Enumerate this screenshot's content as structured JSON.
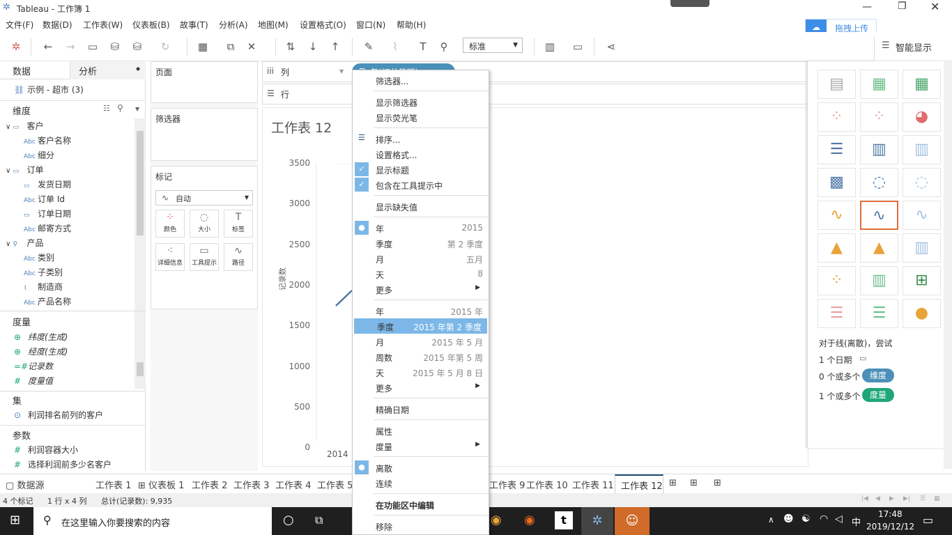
{
  "window": {
    "title": "Tableau - 工作簿 1"
  },
  "menu": [
    "文件(F)",
    "数据(D)",
    "工作表(W)",
    "仪表板(B)",
    "故事(T)",
    "分析(A)",
    "地图(M)",
    "设置格式(O)",
    "窗口(N)",
    "帮助(H)"
  ],
  "toolbar": {
    "fit_value": "标准",
    "upload_label": "拖拽上传",
    "show_me_label": "智能显示"
  },
  "left_pane": {
    "tab_data": "数据",
    "tab_analysis": "分析",
    "datasource": "示例 - 超市 (3)",
    "dimensions_label": "维度",
    "dimension_items": [
      {
        "label": "客户",
        "kind": "folder",
        "icon": "folder-icon"
      },
      {
        "label": "客户名称",
        "kind": "field",
        "icon": "abc-icon"
      },
      {
        "label": "细分",
        "kind": "field",
        "icon": "abc-icon"
      },
      {
        "label": "订单",
        "kind": "folder",
        "icon": "folder-icon"
      },
      {
        "label": "发货日期",
        "kind": "field",
        "icon": "calendar-icon"
      },
      {
        "label": "订单 Id",
        "kind": "field",
        "icon": "abc-icon"
      },
      {
        "label": "订单日期",
        "kind": "field",
        "icon": "calendar-icon"
      },
      {
        "label": "邮寄方式",
        "kind": "field",
        "icon": "abc-icon"
      },
      {
        "label": "产品",
        "kind": "folder",
        "icon": "hierarchy-icon"
      },
      {
        "label": "类别",
        "kind": "field",
        "icon": "abc-icon"
      },
      {
        "label": "子类别",
        "kind": "field",
        "icon": "abc-icon"
      },
      {
        "label": "制造商",
        "kind": "field",
        "icon": "paperclip-icon"
      },
      {
        "label": "产品名称",
        "kind": "field",
        "icon": "abc-icon"
      }
    ],
    "measures_label": "度量",
    "measure_items": [
      "纬度(生成)",
      "经度(生成)",
      "记录数",
      "度量值"
    ],
    "sets_label": "集",
    "set_items": [
      "利润排名前列的客户"
    ],
    "params_label": "参数",
    "param_items": [
      "利润容器大小",
      "选择利润前多少名客户"
    ]
  },
  "shelves": {
    "pages_label": "页面",
    "filters_label": "筛选器",
    "marks_label": "标记",
    "marks_type": "自动",
    "mark_buttons": [
      "颜色",
      "大小",
      "标签",
      "详细信息",
      "工具提示",
      "路径"
    ],
    "columns_label": "列",
    "rows_label": "行",
    "column_pill": "年(订单日期)"
  },
  "view": {
    "title": "工作表 12",
    "y_axis_label": "记录数",
    "y_ticks": [
      "3500",
      "3000",
      "2500",
      "2000",
      "1500",
      "1000",
      "500",
      "0"
    ],
    "x_tick": "2014"
  },
  "context_menu": {
    "items": [
      {
        "label": "筛选器..."
      },
      {
        "sep": true
      },
      {
        "label": "显示筛选器"
      },
      {
        "label": "显示荧光笔"
      },
      {
        "sep": true
      },
      {
        "label": "排序...",
        "icon": "sort-icon"
      },
      {
        "label": "设置格式..."
      },
      {
        "label": "显示标题",
        "checked": true
      },
      {
        "label": "包含在工具提示中",
        "checked": true
      },
      {
        "sep": true
      },
      {
        "label": "显示缺失值"
      },
      {
        "sep": true
      },
      {
        "label": "年",
        "value": "2015",
        "selected": true
      },
      {
        "label": "季度",
        "value": "第 2 季度"
      },
      {
        "label": "月",
        "value": "五月"
      },
      {
        "label": "天",
        "value": "8"
      },
      {
        "label": "更多",
        "submenu": true
      },
      {
        "sep": true
      },
      {
        "label": "年",
        "value": "2015 年"
      },
      {
        "label": "季度",
        "value": "2015 年第 2 季度",
        "highlight": true
      },
      {
        "label": "月",
        "value": "2015 年 5 月"
      },
      {
        "label": "周数",
        "value": "2015 年第 5 周"
      },
      {
        "label": "天",
        "value": "2015 年 5 月 8 日"
      },
      {
        "label": "更多",
        "submenu": true
      },
      {
        "sep": true
      },
      {
        "label": "精确日期"
      },
      {
        "sep": true
      },
      {
        "label": "属性"
      },
      {
        "label": "度量",
        "submenu": true
      },
      {
        "sep": true
      },
      {
        "label": "离散",
        "selected": true
      },
      {
        "label": "连续"
      },
      {
        "sep": true
      },
      {
        "label": "在功能区中编辑",
        "bold": true
      },
      {
        "sep": true
      },
      {
        "label": "移除"
      }
    ]
  },
  "show_me": {
    "hint": "对于线(离散)，尝试",
    "req1": "1 个日期",
    "req2_prefix": "0 个或多个",
    "req2_pill": "维度",
    "req3_prefix": "1 个或多个",
    "req3_pill": "度量",
    "dimension_color": "#4a90b8",
    "measure_color": "#1fa67a"
  },
  "sheet_tabs": [
    "数据源",
    "工作表 1",
    "仪表板 1",
    "工作表 2",
    "工作表 3",
    "工作表 4",
    "工作表 5",
    "工作表 9",
    "工作表 10",
    "工作表 11",
    "工作表 12"
  ],
  "status": {
    "marks": "4 个标记",
    "dims": "1 行 x 4 列",
    "total": "总计(记录数): 9,935"
  },
  "taskbar": {
    "search_placeholder": "在这里输入你要搜索的内容",
    "time": "17:48",
    "date": "2019/12/12",
    "ime": "中"
  }
}
